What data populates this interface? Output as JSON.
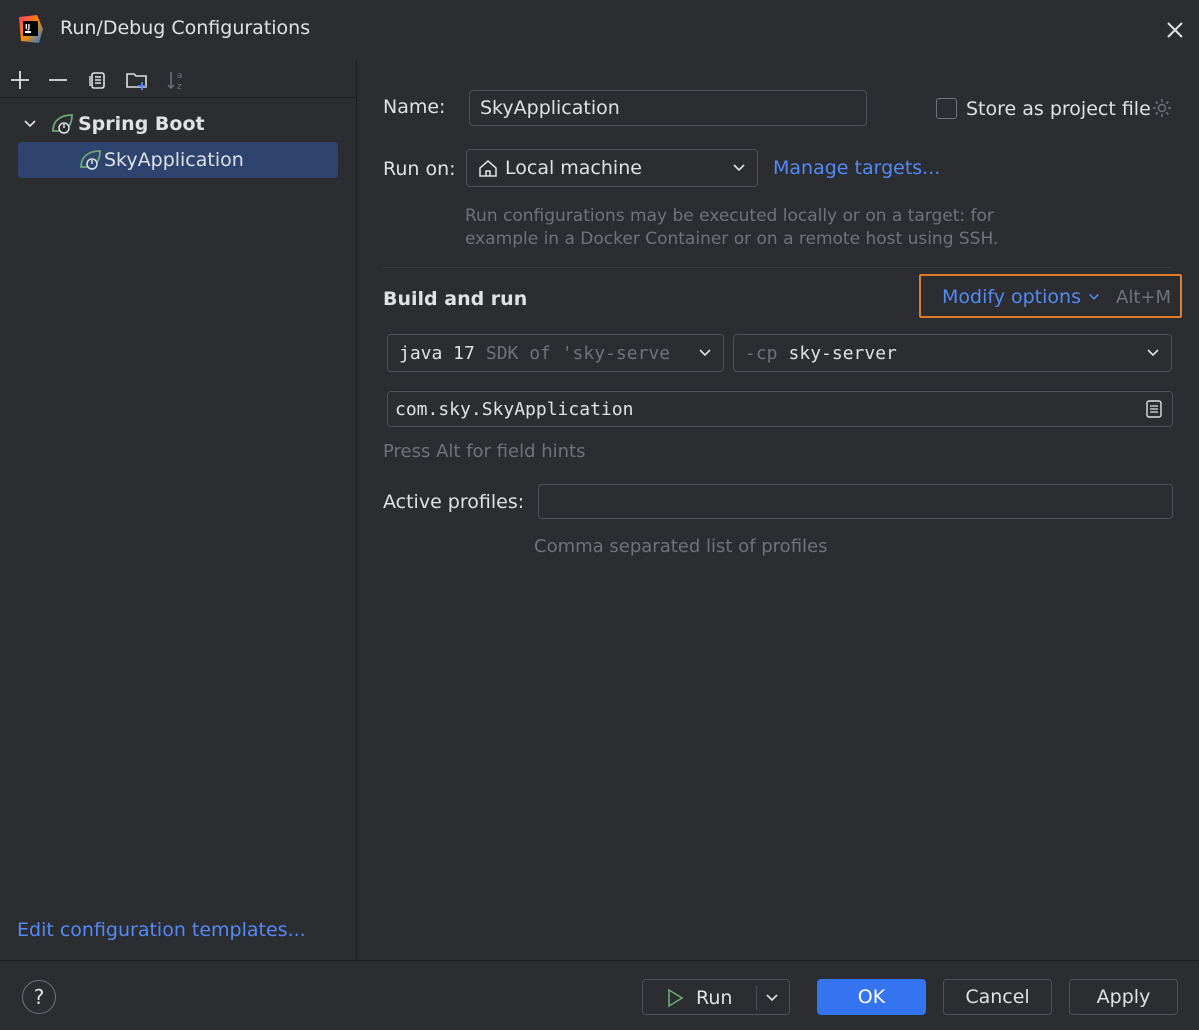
{
  "window": {
    "title": "Run/Debug Configurations"
  },
  "sidebar": {
    "tree": {
      "group_label": "Spring Boot",
      "item_label": "SkyApplication"
    },
    "edit_templates_link": "Edit configuration templates..."
  },
  "form": {
    "name_label": "Name:",
    "name_value": "SkyApplication",
    "store_project_label": "Store as project file",
    "run_on_label": "Run on:",
    "run_on_value": "Local machine",
    "manage_targets_link": "Manage targets...",
    "run_on_hint_line1": "Run configurations may be executed locally or on a target: for",
    "run_on_hint_line2": "example in a Docker Container or on a remote host using SSH.",
    "build_run_title": "Build and run",
    "modify_options_label": "Modify options",
    "modify_options_shortcut": "Alt+M",
    "sdk_strong": "java 17",
    "sdk_muted": "SDK of 'sky-serve",
    "cp_prefix": "-cp",
    "cp_value": "sky-server",
    "main_class_value": "com.sky.SkyApplication",
    "field_hints": "Press Alt for field hints",
    "active_profiles_label": "Active profiles:",
    "active_profiles_value": "",
    "active_profiles_hint": "Comma separated list of profiles"
  },
  "footer": {
    "help_label": "?",
    "run_label": "Run",
    "ok_label": "OK",
    "cancel_label": "Cancel",
    "apply_label": "Apply"
  },
  "colors": {
    "background": "#2b2d30",
    "accent_link": "#548af7",
    "primary_button": "#3574f0",
    "selection": "#2e436e",
    "highlight_border": "#e07b2a",
    "spring_green": "#6aab73"
  }
}
